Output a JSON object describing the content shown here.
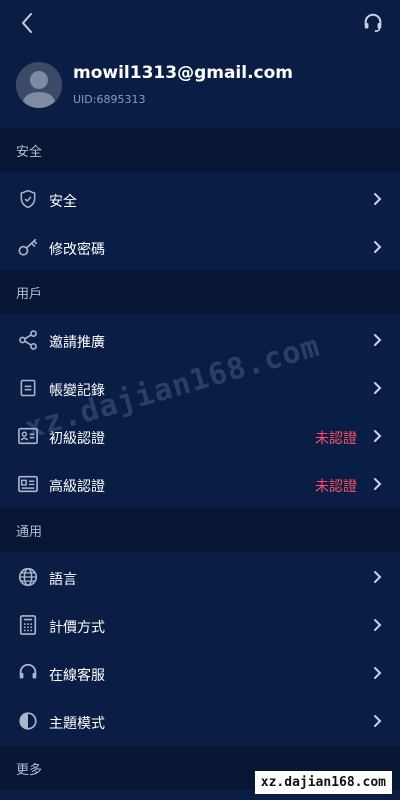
{
  "header": {
    "back_icon": "chevron-left-icon",
    "support_icon": "headset-icon"
  },
  "profile": {
    "email": "mowil1313@gmail.com",
    "uid": "UID:6895313"
  },
  "sections": {
    "security": {
      "title": "安全",
      "items": [
        {
          "label": "安全",
          "icon": "shield-check-icon"
        },
        {
          "label": "修改密碼",
          "icon": "key-icon"
        }
      ]
    },
    "user": {
      "title": "用戶",
      "items": [
        {
          "label": "邀請推廣",
          "icon": "share-icon"
        },
        {
          "label": "帳變記錄",
          "icon": "record-icon"
        },
        {
          "label": "初級認證",
          "icon": "id-card-icon",
          "status": "未認證"
        },
        {
          "label": "高級認證",
          "icon": "id-card-advanced-icon",
          "status": "未認證"
        }
      ]
    },
    "general": {
      "title": "通用",
      "items": [
        {
          "label": "語言",
          "icon": "globe-icon"
        },
        {
          "label": "計價方式",
          "icon": "calculator-icon"
        },
        {
          "label": "在線客服",
          "icon": "headset-icon"
        },
        {
          "label": "主題模式",
          "icon": "contrast-icon"
        }
      ]
    },
    "more": {
      "title": "更多"
    }
  },
  "watermark": {
    "text": "xz.dajian168.com",
    "footer": "xz.dajian168.com"
  },
  "colors": {
    "background": "#0a1e45",
    "section_bg": "#071632",
    "status": "#ff4d6b",
    "secondary_text": "#8c9ab5"
  }
}
